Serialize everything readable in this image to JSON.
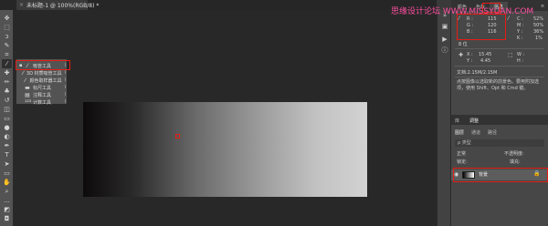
{
  "document_tab": {
    "close_glyph": "×",
    "title": "未标题-1 @ 100%(RGB/8) *"
  },
  "toolbar": {
    "tools": [
      {
        "name": "move-tool-icon",
        "glyph": "✥"
      },
      {
        "name": "marquee-tool-icon",
        "glyph": "⬚"
      },
      {
        "name": "lasso-tool-icon",
        "glyph": "ↄ"
      },
      {
        "name": "quick-select-tool-icon",
        "glyph": "✎"
      },
      {
        "name": "crop-tool-icon",
        "glyph": "⌗"
      },
      {
        "name": "eyedropper-tool-icon",
        "glyph": "⁄"
      },
      {
        "name": "healing-brush-tool-icon",
        "glyph": "✚"
      },
      {
        "name": "brush-tool-icon",
        "glyph": "✏"
      },
      {
        "name": "clone-stamp-tool-icon",
        "glyph": "♣"
      },
      {
        "name": "history-brush-tool-icon",
        "glyph": "↺"
      },
      {
        "name": "eraser-tool-icon",
        "glyph": "◫"
      },
      {
        "name": "gradient-tool-icon",
        "glyph": "▭"
      },
      {
        "name": "blur-tool-icon",
        "glyph": "●"
      },
      {
        "name": "dodge-tool-icon",
        "glyph": "◐"
      },
      {
        "name": "pen-tool-icon",
        "glyph": "✒"
      },
      {
        "name": "type-tool-icon",
        "glyph": "T"
      },
      {
        "name": "path-select-tool-icon",
        "glyph": "➤"
      },
      {
        "name": "shape-tool-icon",
        "glyph": "▭"
      },
      {
        "name": "hand-tool-icon",
        "glyph": "✋"
      },
      {
        "name": "zoom-tool-icon",
        "glyph": "⌕"
      },
      {
        "name": "edit-toolbar-icon",
        "glyph": "…"
      },
      {
        "name": "color-swatch-icon",
        "glyph": "◩"
      },
      {
        "name": "quick-mask-icon",
        "glyph": "◘"
      }
    ]
  },
  "flyout": {
    "items": [
      {
        "bullet": "▪",
        "glyph": "⁄",
        "label": "吸管工具",
        "shortcut": "I"
      },
      {
        "bullet": "",
        "glyph": "⁄",
        "label": "3D 材质吸管工具",
        "shortcut": "I"
      },
      {
        "bullet": "",
        "glyph": "⁄",
        "label": "颜色取样器工具",
        "shortcut": "I"
      },
      {
        "bullet": "",
        "glyph": "▬",
        "label": "标尺工具",
        "shortcut": "I"
      },
      {
        "bullet": "",
        "glyph": "▤",
        "label": "注释工具",
        "shortcut": "I"
      },
      {
        "bullet": "",
        "glyph": "¹²³",
        "label": "计数工具",
        "shortcut": "I"
      }
    ]
  },
  "mini_strip": {
    "icons": [
      {
        "name": "collapse-arrows-icon",
        "glyph": "»"
      },
      {
        "name": "history-panel-icon",
        "glyph": "▣"
      },
      {
        "name": "properties-panel-icon",
        "glyph": "▶"
      },
      {
        "name": "info-panel-icon",
        "glyph": "ⓘ"
      }
    ]
  },
  "right_panel": {
    "top_tabs": [
      "颜色",
      "色板",
      "信息"
    ],
    "collapse_glyph": "≡",
    "info": {
      "rgb": [
        {
          "label": "R :",
          "value": "115"
        },
        {
          "label": "G :",
          "value": "120"
        },
        {
          "label": "B :",
          "value": "116"
        }
      ],
      "cmyk": [
        {
          "label": "C :",
          "value": "52%"
        },
        {
          "label": "M :",
          "value": "50%"
        },
        {
          "label": "Y :",
          "value": "36%"
        },
        {
          "label": "K :",
          "value": "1%"
        }
      ],
      "bit_depth": "8 位",
      "xy": [
        {
          "label": "X :",
          "value": "15.45"
        },
        {
          "label": "Y :",
          "value": "4.45"
        }
      ],
      "wh": [
        {
          "label": "W :",
          "value": ""
        },
        {
          "label": "H :",
          "value": ""
        }
      ],
      "doc_size": "文档:2.15M/2.15M",
      "description": "点按图像以选取新的前景色。要用附加选项，使用 Shift、Opt 和 Cmd 键。"
    },
    "mid_tabs": [
      "库",
      "调整"
    ],
    "layer_tabs": [
      "图层",
      "通道",
      "路径"
    ],
    "filter_label": "ρ 类型",
    "mode_label": "正常",
    "opacity_label": "不透明度:",
    "lock_label": "锁定:",
    "fill_label": "填充:",
    "layer": {
      "eye": "◉",
      "name": "背景",
      "lock": "🔒"
    }
  },
  "watermark": "思缘设计论坛 WWW.MISSYUAN.COM"
}
